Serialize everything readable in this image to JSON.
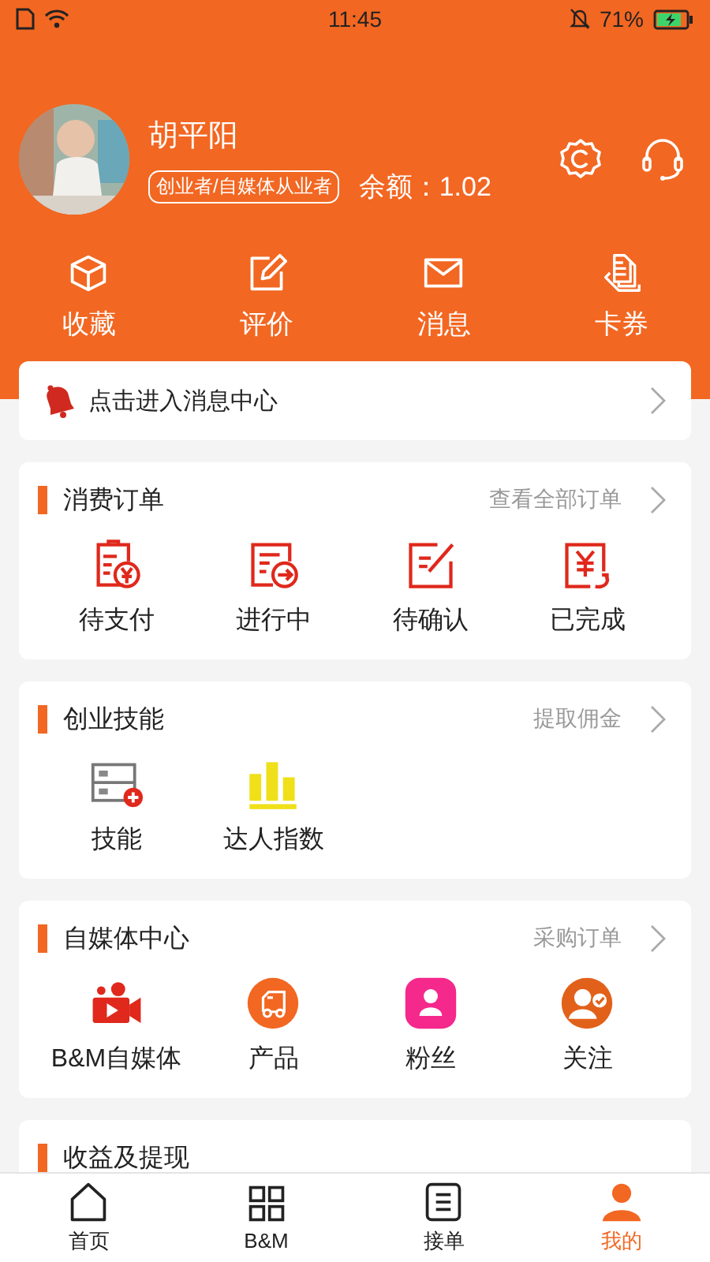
{
  "status_bar": {
    "time": "11:45",
    "battery": "71%"
  },
  "profile": {
    "name": "胡平阳",
    "tag": "创业者/自媒体从业者",
    "balance": "余额：1.02"
  },
  "quick_links": [
    {
      "label": "收藏",
      "kind": "box"
    },
    {
      "label": "评价",
      "kind": "edit"
    },
    {
      "label": "消息",
      "kind": "mail"
    },
    {
      "label": "卡券",
      "kind": "cards"
    }
  ],
  "message_bar": {
    "text": "点击进入消息中心"
  },
  "sections": [
    {
      "title": "消费订单",
      "link": "查看全部订单",
      "items": [
        {
          "label": "待支付",
          "kind": "pay"
        },
        {
          "label": "进行中",
          "kind": "progress"
        },
        {
          "label": "待确认",
          "kind": "confirm"
        },
        {
          "label": "已完成",
          "kind": "done"
        }
      ]
    },
    {
      "title": "创业技能",
      "link": "提取佣金",
      "items": [
        {
          "label": "技能",
          "kind": "skill"
        },
        {
          "label": "达人指数",
          "kind": "chart"
        }
      ]
    },
    {
      "title": "自媒体中心",
      "link": "采购订单",
      "items": [
        {
          "label": "B&M自媒体",
          "kind": "video"
        },
        {
          "label": "产品",
          "kind": "truck"
        },
        {
          "label": "粉丝",
          "kind": "fans"
        },
        {
          "label": "关注",
          "kind": "follow"
        }
      ]
    },
    {
      "title": "收益及提现"
    }
  ],
  "tab_bar": [
    {
      "label": "首页",
      "kind": "home",
      "selected": false
    },
    {
      "label": "B&M",
      "kind": "grid",
      "selected": false
    },
    {
      "label": "接单",
      "kind": "orders",
      "selected": false
    },
    {
      "label": "我的",
      "kind": "person",
      "selected": true
    }
  ]
}
